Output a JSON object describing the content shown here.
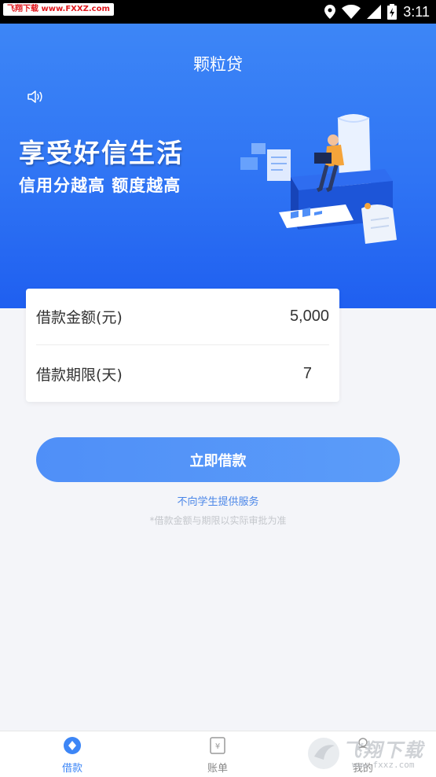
{
  "status_bar": {
    "watermark": "飞翔下载 www.FXXZ.com",
    "time": "3:11"
  },
  "banner": {
    "title": "颗粒贷",
    "slogan": "享受好信生活",
    "subslogan": "信用分越高 额度越高"
  },
  "form": {
    "amount_label": "借款金额(元)",
    "amount_value": "5,000",
    "term_label": "借款期限(天)",
    "term_value": "7"
  },
  "actions": {
    "borrow_label": "立即借款"
  },
  "notice": "不向学生提供服务",
  "disclaimer": "*借款金额与期限以实际审批为准",
  "bottom_nav": {
    "items": [
      {
        "label": "借款",
        "icon": "loan-icon",
        "active": true
      },
      {
        "label": "账单",
        "icon": "bill-icon",
        "active": false
      },
      {
        "label": "我的",
        "icon": "profile-icon",
        "active": false
      }
    ]
  },
  "corner_watermark": {
    "text": "飞翔下载",
    "url": "www.fxxz.com"
  },
  "colors": {
    "primary": "#3d86f6",
    "button": "#5496f8",
    "background": "#f4f5f9"
  }
}
